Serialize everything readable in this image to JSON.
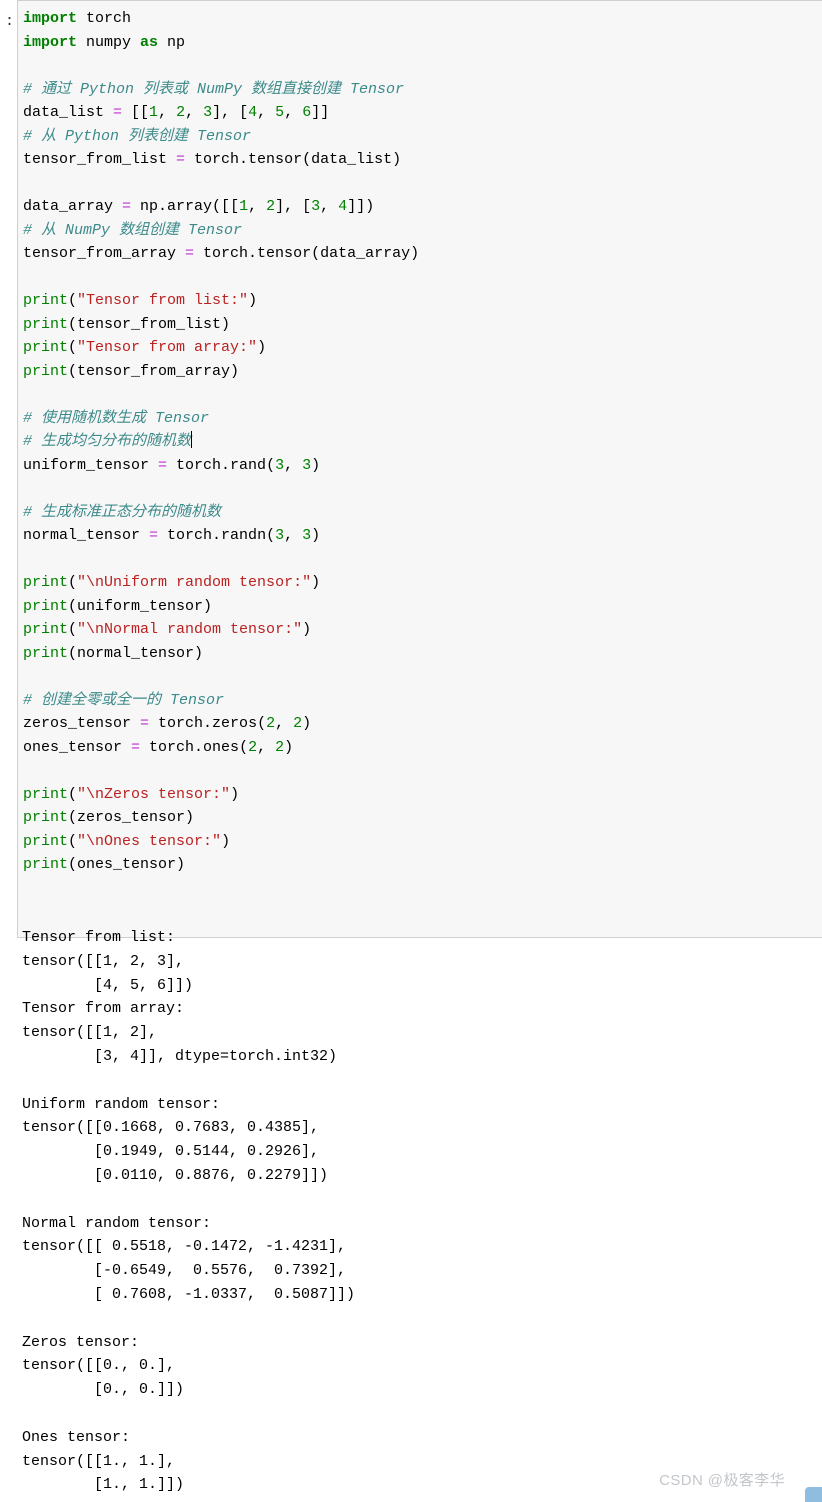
{
  "cell": {
    "prompt": ":",
    "code_lines": [
      [
        {
          "t": "kw",
          "s": "import"
        },
        {
          "t": "pl",
          "s": " torch"
        }
      ],
      [
        {
          "t": "kw",
          "s": "import"
        },
        {
          "t": "pl",
          "s": " numpy "
        },
        {
          "t": "kw",
          "s": "as"
        },
        {
          "t": "pl",
          "s": " np"
        }
      ],
      [],
      [
        {
          "t": "cmt",
          "s": "# 通过 Python 列表或 NumPy 数组直接创建 Tensor"
        }
      ],
      [
        {
          "t": "pl",
          "s": "data_list "
        },
        {
          "t": "op",
          "s": "="
        },
        {
          "t": "pl",
          "s": " [["
        },
        {
          "t": "num",
          "s": "1"
        },
        {
          "t": "pl",
          "s": ", "
        },
        {
          "t": "num",
          "s": "2"
        },
        {
          "t": "pl",
          "s": ", "
        },
        {
          "t": "num",
          "s": "3"
        },
        {
          "t": "pl",
          "s": "], ["
        },
        {
          "t": "num",
          "s": "4"
        },
        {
          "t": "pl",
          "s": ", "
        },
        {
          "t": "num",
          "s": "5"
        },
        {
          "t": "pl",
          "s": ", "
        },
        {
          "t": "num",
          "s": "6"
        },
        {
          "t": "pl",
          "s": "]]"
        }
      ],
      [
        {
          "t": "cmt",
          "s": "# 从 Python 列表创建 Tensor"
        }
      ],
      [
        {
          "t": "pl",
          "s": "tensor_from_list "
        },
        {
          "t": "op",
          "s": "="
        },
        {
          "t": "pl",
          "s": " torch.tensor(data_list)"
        }
      ],
      [],
      [
        {
          "t": "pl",
          "s": "data_array "
        },
        {
          "t": "op",
          "s": "="
        },
        {
          "t": "pl",
          "s": " np.array([["
        },
        {
          "t": "num",
          "s": "1"
        },
        {
          "t": "pl",
          "s": ", "
        },
        {
          "t": "num",
          "s": "2"
        },
        {
          "t": "pl",
          "s": "], ["
        },
        {
          "t": "num",
          "s": "3"
        },
        {
          "t": "pl",
          "s": ", "
        },
        {
          "t": "num",
          "s": "4"
        },
        {
          "t": "pl",
          "s": "]])"
        }
      ],
      [
        {
          "t": "cmt",
          "s": "# 从 NumPy 数组创建 Tensor"
        }
      ],
      [
        {
          "t": "pl",
          "s": "tensor_from_array "
        },
        {
          "t": "op",
          "s": "="
        },
        {
          "t": "pl",
          "s": " torch.tensor(data_array)"
        }
      ],
      [],
      [
        {
          "t": "fn",
          "s": "print"
        },
        {
          "t": "pl",
          "s": "("
        },
        {
          "t": "str",
          "s": "\"Tensor from list:\""
        },
        {
          "t": "pl",
          "s": ")"
        }
      ],
      [
        {
          "t": "fn",
          "s": "print"
        },
        {
          "t": "pl",
          "s": "(tensor_from_list)"
        }
      ],
      [
        {
          "t": "fn",
          "s": "print"
        },
        {
          "t": "pl",
          "s": "("
        },
        {
          "t": "str",
          "s": "\"Tensor from array:\""
        },
        {
          "t": "pl",
          "s": ")"
        }
      ],
      [
        {
          "t": "fn",
          "s": "print"
        },
        {
          "t": "pl",
          "s": "(tensor_from_array)"
        }
      ],
      [],
      [
        {
          "t": "cmt",
          "s": "# 使用随机数生成 Tensor"
        }
      ],
      [
        {
          "t": "cmt",
          "s": "# 生成均匀分布的随机数"
        },
        {
          "t": "caret",
          "s": ""
        }
      ],
      [
        {
          "t": "pl",
          "s": "uniform_tensor "
        },
        {
          "t": "op",
          "s": "="
        },
        {
          "t": "pl",
          "s": " torch.rand("
        },
        {
          "t": "num",
          "s": "3"
        },
        {
          "t": "pl",
          "s": ", "
        },
        {
          "t": "num",
          "s": "3"
        },
        {
          "t": "pl",
          "s": ")"
        }
      ],
      [],
      [
        {
          "t": "cmt",
          "s": "# 生成标准正态分布的随机数"
        }
      ],
      [
        {
          "t": "pl",
          "s": "normal_tensor "
        },
        {
          "t": "op",
          "s": "="
        },
        {
          "t": "pl",
          "s": " torch.randn("
        },
        {
          "t": "num",
          "s": "3"
        },
        {
          "t": "pl",
          "s": ", "
        },
        {
          "t": "num",
          "s": "3"
        },
        {
          "t": "pl",
          "s": ")"
        }
      ],
      [],
      [
        {
          "t": "fn",
          "s": "print"
        },
        {
          "t": "pl",
          "s": "("
        },
        {
          "t": "str",
          "s": "\"\\nUniform random tensor:\""
        },
        {
          "t": "pl",
          "s": ")"
        }
      ],
      [
        {
          "t": "fn",
          "s": "print"
        },
        {
          "t": "pl",
          "s": "(uniform_tensor)"
        }
      ],
      [
        {
          "t": "fn",
          "s": "print"
        },
        {
          "t": "pl",
          "s": "("
        },
        {
          "t": "str",
          "s": "\"\\nNormal random tensor:\""
        },
        {
          "t": "pl",
          "s": ")"
        }
      ],
      [
        {
          "t": "fn",
          "s": "print"
        },
        {
          "t": "pl",
          "s": "(normal_tensor)"
        }
      ],
      [],
      [
        {
          "t": "cmt",
          "s": "# 创建全零或全一的 Tensor"
        }
      ],
      [
        {
          "t": "pl",
          "s": "zeros_tensor "
        },
        {
          "t": "op",
          "s": "="
        },
        {
          "t": "pl",
          "s": " torch.zeros("
        },
        {
          "t": "num",
          "s": "2"
        },
        {
          "t": "pl",
          "s": ", "
        },
        {
          "t": "num",
          "s": "2"
        },
        {
          "t": "pl",
          "s": ")"
        }
      ],
      [
        {
          "t": "pl",
          "s": "ones_tensor "
        },
        {
          "t": "op",
          "s": "="
        },
        {
          "t": "pl",
          "s": " torch.ones("
        },
        {
          "t": "num",
          "s": "2"
        },
        {
          "t": "pl",
          "s": ", "
        },
        {
          "t": "num",
          "s": "2"
        },
        {
          "t": "pl",
          "s": ")"
        }
      ],
      [],
      [
        {
          "t": "fn",
          "s": "print"
        },
        {
          "t": "pl",
          "s": "("
        },
        {
          "t": "str",
          "s": "\"\\nZeros tensor:\""
        },
        {
          "t": "pl",
          "s": ")"
        }
      ],
      [
        {
          "t": "fn",
          "s": "print"
        },
        {
          "t": "pl",
          "s": "(zeros_tensor)"
        }
      ],
      [
        {
          "t": "fn",
          "s": "print"
        },
        {
          "t": "pl",
          "s": "("
        },
        {
          "t": "str",
          "s": "\"\\nOnes tensor:\""
        },
        {
          "t": "pl",
          "s": ")"
        }
      ],
      [
        {
          "t": "fn",
          "s": "print"
        },
        {
          "t": "pl",
          "s": "(ones_tensor)"
        }
      ]
    ]
  },
  "output": {
    "lines": [
      "Tensor from list:",
      "tensor([[1, 2, 3],",
      "        [4, 5, 6]])",
      "Tensor from array:",
      "tensor([[1, 2],",
      "        [3, 4]], dtype=torch.int32)",
      "",
      "Uniform random tensor:",
      "tensor([[0.1668, 0.7683, 0.4385],",
      "        [0.1949, 0.5144, 0.2926],",
      "        [0.0110, 0.8876, 0.2279]])",
      "",
      "Normal random tensor:",
      "tensor([[ 0.5518, -0.1472, -1.4231],",
      "        [-0.6549,  0.5576,  0.7392],",
      "        [ 0.7608, -1.0337,  0.5087]])",
      "",
      "Zeros tensor:",
      "tensor([[0., 0.],",
      "        [0., 0.]])",
      "",
      "Ones tensor:",
      "tensor([[1., 1.],",
      "        [1., 1.]])"
    ]
  },
  "watermark": {
    "text": "CSDN @极客李华"
  },
  "colors": {
    "cell_background": "#f7f7f7",
    "cell_border": "#cfcfcf",
    "keyword": "#008000",
    "comment": "#3d8a8a",
    "string": "#ba2121",
    "number": "#008000",
    "operator": "#bb33cc",
    "function": "#008000",
    "text": "#000000",
    "watermark": "#c3c6ca",
    "corner_marker": "#8fbde0"
  }
}
